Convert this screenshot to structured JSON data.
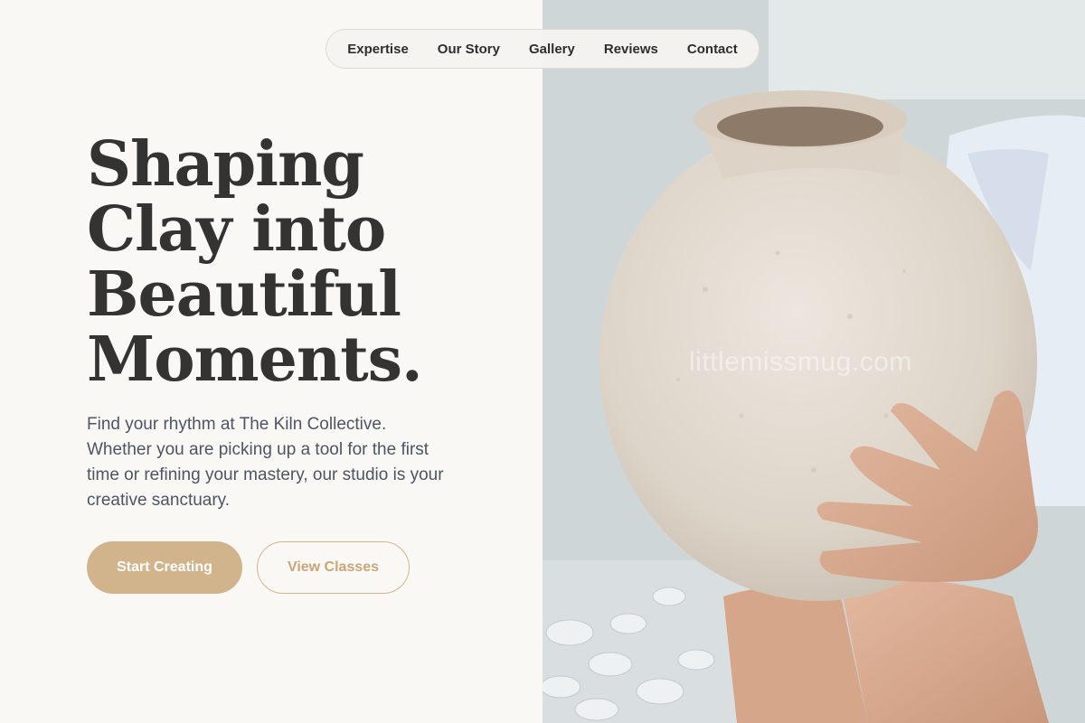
{
  "nav": {
    "items": [
      {
        "label": "Expertise"
      },
      {
        "label": "Our Story"
      },
      {
        "label": "Gallery"
      },
      {
        "label": "Reviews"
      },
      {
        "label": "Contact"
      }
    ]
  },
  "hero": {
    "headline_lines": [
      "Shaping",
      "Clay into",
      "Beautiful",
      "Moments."
    ],
    "description": "Find your rhythm at The Kiln Collective. Whether you are picking up a tool for the first time or refining your mastery, our studio is your creative sanctuary.",
    "primary_cta": "Start Creating",
    "secondary_cta": "View Classes"
  },
  "image": {
    "watermark": "littlemissmug.com"
  },
  "colors": {
    "accent": "#d2b48c",
    "background": "#faf8f5",
    "heading": "#333331",
    "body_text": "#4b5563"
  }
}
